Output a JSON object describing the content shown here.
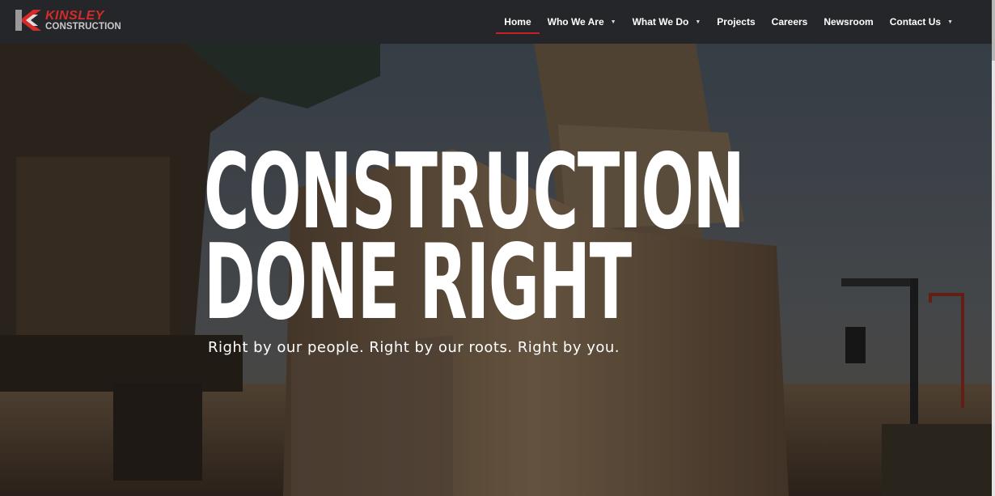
{
  "brand": {
    "name_line1": "KINSLEY",
    "name_line2": "CONSTRUCTION",
    "accent_color": "#c8202a"
  },
  "nav": {
    "items": [
      {
        "label": "Home",
        "active": true,
        "dropdown": false
      },
      {
        "label": "Who We Are",
        "active": false,
        "dropdown": true
      },
      {
        "label": "What We Do",
        "active": false,
        "dropdown": true
      },
      {
        "label": "Projects",
        "active": false,
        "dropdown": false
      },
      {
        "label": "Careers",
        "active": false,
        "dropdown": false
      },
      {
        "label": "Newsroom",
        "active": false,
        "dropdown": false
      },
      {
        "label": "Contact Us",
        "active": false,
        "dropdown": true
      }
    ],
    "caret_icon": "caret-down-icon"
  },
  "hero": {
    "headline_line1": "CONSTRUCTION",
    "headline_line2": "DONE RIGHT",
    "subheadline": "Right by our people. Right by our roots. Right by you."
  }
}
